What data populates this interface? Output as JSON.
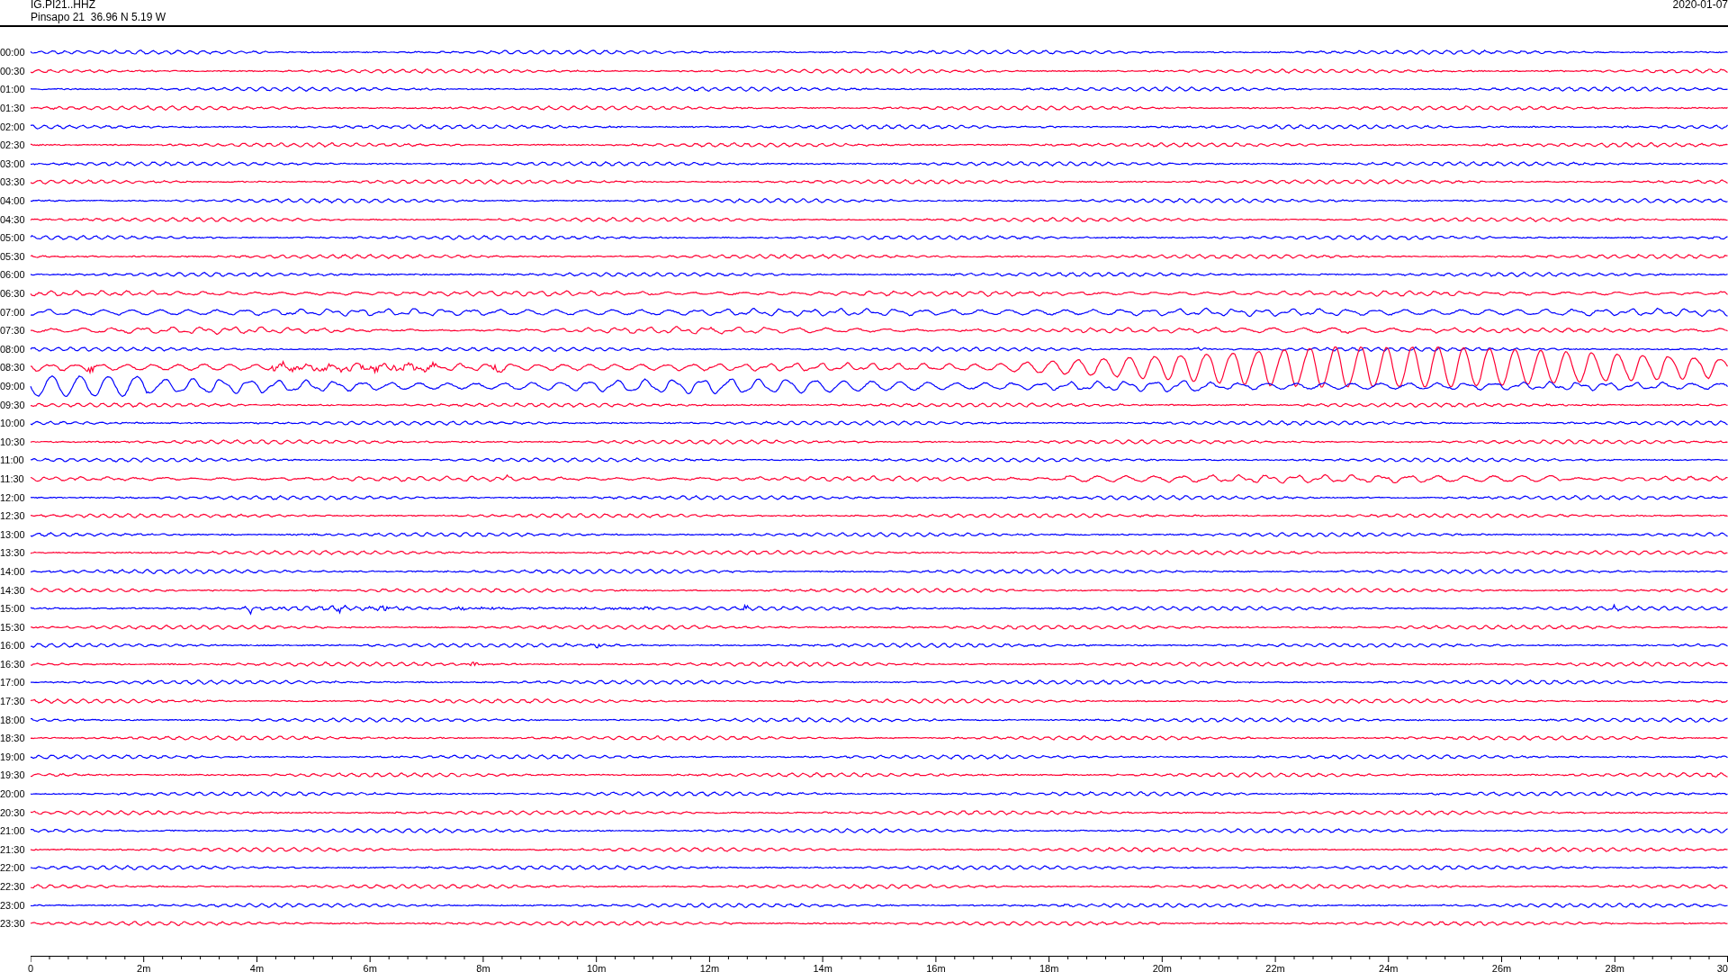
{
  "header": {
    "station": "IG.PI21..HHZ",
    "location": "Pinsapo 21  36.96 N 5.19 W",
    "date": "2020-01-07"
  },
  "rows": [
    {
      "time": "00:00",
      "color": "#0000ff"
    },
    {
      "time": "00:30",
      "color": "#ff0033"
    },
    {
      "time": "01:00",
      "color": "#0000ff"
    },
    {
      "time": "01:30",
      "color": "#ff0033"
    },
    {
      "time": "02:00",
      "color": "#0000ff"
    },
    {
      "time": "02:30",
      "color": "#ff0033"
    },
    {
      "time": "03:00",
      "color": "#0000ff"
    },
    {
      "time": "03:30",
      "color": "#ff0033"
    },
    {
      "time": "04:00",
      "color": "#0000ff"
    },
    {
      "time": "04:30",
      "color": "#ff0033"
    },
    {
      "time": "05:00",
      "color": "#0000ff"
    },
    {
      "time": "05:30",
      "color": "#ff0033"
    },
    {
      "time": "06:00",
      "color": "#0000ff"
    },
    {
      "time": "06:30",
      "color": "#ff0033"
    },
    {
      "time": "07:00",
      "color": "#0000ff"
    },
    {
      "time": "07:30",
      "color": "#ff0033"
    },
    {
      "time": "08:00",
      "color": "#0000ff"
    },
    {
      "time": "08:30",
      "color": "#ff0033"
    },
    {
      "time": "09:00",
      "color": "#0000ff"
    },
    {
      "time": "09:30",
      "color": "#ff0033"
    },
    {
      "time": "10:00",
      "color": "#0000ff"
    },
    {
      "time": "10:30",
      "color": "#ff0033"
    },
    {
      "time": "11:00",
      "color": "#0000ff"
    },
    {
      "time": "11:30",
      "color": "#ff0033"
    },
    {
      "time": "12:00",
      "color": "#0000ff"
    },
    {
      "time": "12:30",
      "color": "#ff0033"
    },
    {
      "time": "13:00",
      "color": "#0000ff"
    },
    {
      "time": "13:30",
      "color": "#ff0033"
    },
    {
      "time": "14:00",
      "color": "#0000ff"
    },
    {
      "time": "14:30",
      "color": "#ff0033"
    },
    {
      "time": "15:00",
      "color": "#0000ff"
    },
    {
      "time": "15:30",
      "color": "#ff0033"
    },
    {
      "time": "16:00",
      "color": "#0000ff"
    },
    {
      "time": "16:30",
      "color": "#ff0033"
    },
    {
      "time": "17:00",
      "color": "#0000ff"
    },
    {
      "time": "17:30",
      "color": "#ff0033"
    },
    {
      "time": "18:00",
      "color": "#0000ff"
    },
    {
      "time": "18:30",
      "color": "#ff0033"
    },
    {
      "time": "19:00",
      "color": "#0000ff"
    },
    {
      "time": "19:30",
      "color": "#ff0033"
    },
    {
      "time": "20:00",
      "color": "#0000ff"
    },
    {
      "time": "20:30",
      "color": "#ff0033"
    },
    {
      "time": "21:00",
      "color": "#0000ff"
    },
    {
      "time": "21:30",
      "color": "#ff0033"
    },
    {
      "time": "22:00",
      "color": "#0000ff"
    },
    {
      "time": "22:30",
      "color": "#ff0033"
    },
    {
      "time": "23:00",
      "color": "#0000ff"
    },
    {
      "time": "23:30",
      "color": "#ff0033"
    }
  ],
  "x_axis": {
    "ticks": [
      "0",
      "2m",
      "4m",
      "6m",
      "8m",
      "10m",
      "12m",
      "14m",
      "16m",
      "18m",
      "20m",
      "22m",
      "24m",
      "26m",
      "28m",
      "30"
    ]
  }
}
